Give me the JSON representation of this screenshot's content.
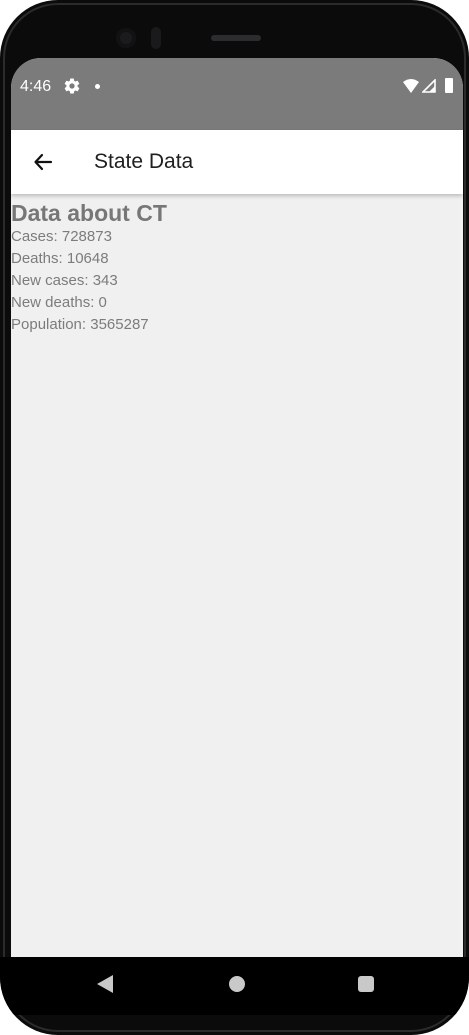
{
  "status_bar": {
    "time": "4:46",
    "icons": [
      "gear-icon",
      "notification-dot-icon",
      "wifi-icon",
      "cellular-signal-icon",
      "battery-icon"
    ]
  },
  "app_bar": {
    "title": "State Data",
    "back_icon": "arrow-back-icon"
  },
  "content": {
    "heading": "Data about CT",
    "lines": [
      "Cases: 728873",
      "Deaths: 10648",
      "New cases: 343",
      "New deaths: 0",
      "Population: 3565287"
    ]
  },
  "nav_bar": {
    "icons": [
      "triangle-back-icon",
      "circle-home-icon",
      "square-recents-icon"
    ]
  },
  "colors": {
    "status_bar": "#7b7b7b",
    "app_bar": "#ffffff",
    "background": "#f0f0f0",
    "text_gray": "#7a7a7a",
    "nav_bar": "#000000"
  }
}
